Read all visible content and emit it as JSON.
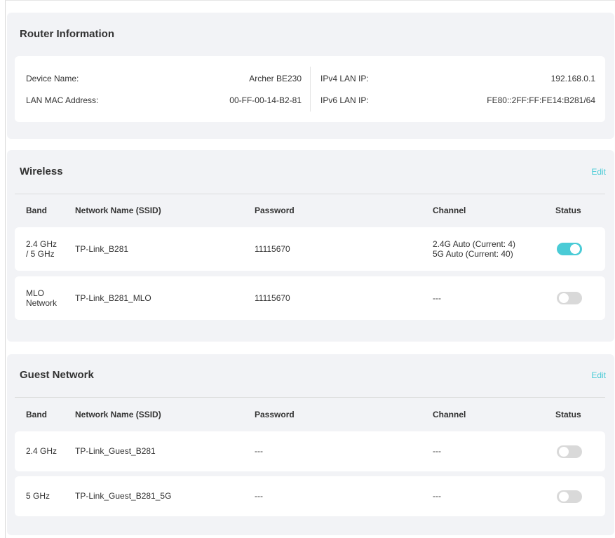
{
  "router_info": {
    "title": "Router Information",
    "device_name_label": "Device Name:",
    "device_name": "Archer BE230",
    "lan_mac_label": "LAN MAC Address:",
    "lan_mac": "00-FF-00-14-B2-81",
    "ipv4_label": "IPv4 LAN IP:",
    "ipv4": "192.168.0.1",
    "ipv6_label": "IPv6 LAN IP:",
    "ipv6": "FE80::2FF:FF:FE14:B281/64"
  },
  "wireless": {
    "title": "Wireless",
    "edit_label": "Edit",
    "headers": {
      "band": "Band",
      "ssid": "Network Name (SSID)",
      "password": "Password",
      "channel": "Channel",
      "status": "Status"
    },
    "rows": [
      {
        "band_line1": "2.4 GHz",
        "band_line2": "/ 5 GHz",
        "ssid": "TP-Link_B281",
        "password": "11115670",
        "channel_line1": "2.4G Auto (Current: 4)",
        "channel_line2": "5G Auto (Current: 40)",
        "status_on": true
      },
      {
        "band_line1": "MLO",
        "band_line2": "Network",
        "ssid": "TP-Link_B281_MLO",
        "password": "11115670",
        "channel_line1": "---",
        "channel_line2": "",
        "status_on": false
      }
    ]
  },
  "guest": {
    "title": "Guest Network",
    "edit_label": "Edit",
    "headers": {
      "band": "Band",
      "ssid": "Network Name (SSID)",
      "password": "Password",
      "channel": "Channel",
      "status": "Status"
    },
    "rows": [
      {
        "band": "2.4 GHz",
        "ssid": "TP-Link_Guest_B281",
        "password": "---",
        "channel": "---",
        "status_on": false
      },
      {
        "band": "5 GHz",
        "ssid": "TP-Link_Guest_B281_5G",
        "password": "---",
        "channel": "---",
        "status_on": false
      }
    ]
  },
  "colors": {
    "accent": "#4acbd6",
    "panel_bg": "#f2f3f6",
    "toggle_off": "#d9d9d9"
  }
}
